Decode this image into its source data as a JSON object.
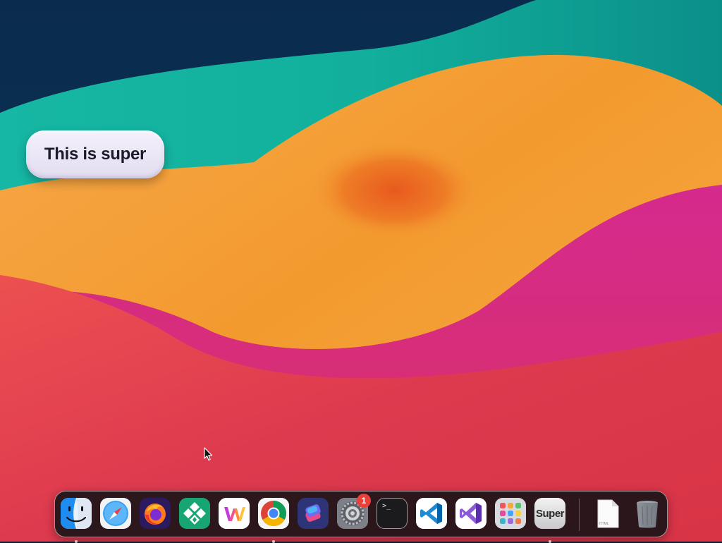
{
  "desktop": {
    "pill": {
      "label": "This is super"
    }
  },
  "colors": {
    "wallpaper_top": "#082a4a",
    "wallpaper_teal": "#17b6a6",
    "wallpaper_orange": "#f19a2e",
    "wallpaper_magenta": "#cf2587",
    "wallpaper_red": "#de3a4d",
    "dock_background": "#121216",
    "badge_red": "#e9403a"
  },
  "dock": {
    "items": [
      {
        "id": "finder",
        "label": "Finder",
        "icon": "finder-icon",
        "running": true
      },
      {
        "id": "safari",
        "label": "Safari",
        "icon": "safari-compass-icon",
        "running": false
      },
      {
        "id": "firefox",
        "label": "Firefox",
        "icon": "firefox-icon",
        "running": false
      },
      {
        "id": "diamond-app",
        "label": "",
        "icon": "green-diamond-grid-icon",
        "running": false
      },
      {
        "id": "w-app",
        "label": "",
        "icon": "colorful-w-icon",
        "running": false
      },
      {
        "id": "chrome",
        "label": "Google Chrome",
        "icon": "chrome-icon",
        "running": true
      },
      {
        "id": "shortcuts",
        "label": "Shortcuts",
        "icon": "shortcuts-icon",
        "running": false
      },
      {
        "id": "system-settings",
        "label": "System Settings",
        "icon": "gear-icon",
        "running": false,
        "badge": "1"
      },
      {
        "id": "terminal",
        "label": "Terminal",
        "icon": "terminal-icon",
        "running": false,
        "prompt": ">_"
      },
      {
        "id": "vscode",
        "label": "Visual Studio Code",
        "icon": "vscode-icon",
        "running": false
      },
      {
        "id": "visual-studio",
        "label": "Visual Studio",
        "icon": "visual-studio-icon",
        "running": false
      },
      {
        "id": "launchpad",
        "label": "Launchpad",
        "icon": "launchpad-grid-icon",
        "running": false
      },
      {
        "id": "super",
        "label": "Super",
        "icon": "super-app-icon",
        "running": true
      },
      {
        "id": "html-document",
        "label": "",
        "icon": "html-document-icon",
        "running": false,
        "caption": "HTML"
      },
      {
        "id": "trash",
        "label": "Trash",
        "icon": "trash-icon",
        "running": false
      }
    ]
  }
}
